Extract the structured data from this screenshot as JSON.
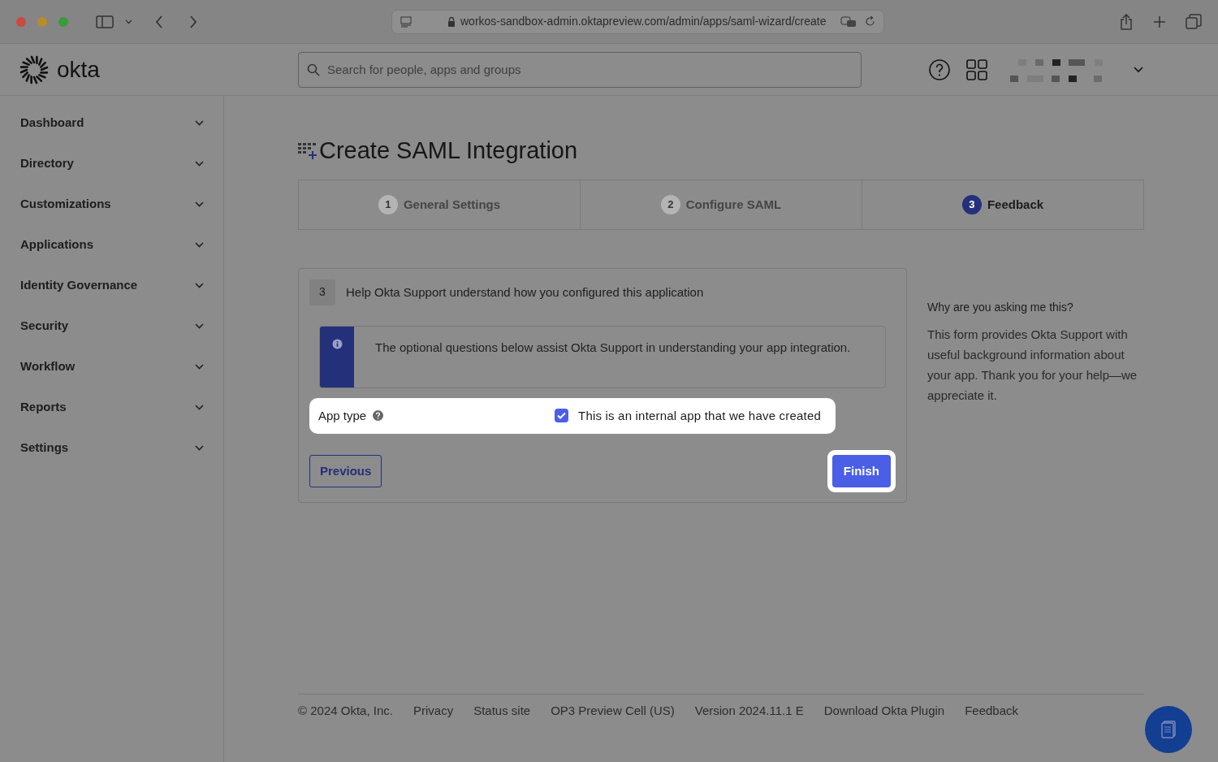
{
  "browser": {
    "url": "workos-sandbox-admin.oktapreview.com/admin/apps/saml-wizard/create"
  },
  "header": {
    "logo": "okta",
    "search": {
      "placeholder": "Search for people, apps and groups"
    }
  },
  "sidebar": {
    "items": [
      {
        "label": "Dashboard"
      },
      {
        "label": "Directory"
      },
      {
        "label": "Customizations"
      },
      {
        "label": "Applications"
      },
      {
        "label": "Identity Governance"
      },
      {
        "label": "Security"
      },
      {
        "label": "Workflow"
      },
      {
        "label": "Reports"
      },
      {
        "label": "Settings"
      }
    ]
  },
  "page": {
    "title": "Create SAML Integration"
  },
  "steps": [
    {
      "number": "1",
      "label": "General Settings",
      "selected": false
    },
    {
      "number": "2",
      "label": "Configure SAML",
      "selected": false
    },
    {
      "number": "3",
      "label": "Feedback",
      "selected": true
    }
  ],
  "section": {
    "number": "3",
    "title": "Help Okta Support understand how you configured this application",
    "info": "The optional questions below assist Okta Support in understanding your app integration.",
    "field": {
      "label": "App type",
      "option": "This is an internal app that we have created",
      "checked": true
    },
    "buttons": [
      {
        "kind": "secondary",
        "label": "Previous"
      },
      {
        "kind": "primary",
        "label": "Finish"
      }
    ]
  },
  "help": {
    "title": "Why are you asking me this?",
    "text": "This form provides Okta Support with useful background information about your app. Thank you for your help—we appreciate it."
  },
  "footer": {
    "links": [
      "© 2024 Okta, Inc.",
      "Privacy",
      "Status site",
      "OP3 Preview Cell (US)",
      "Version 2024.11.1 E",
      "Download Okta Plugin",
      "Feedback"
    ]
  }
}
